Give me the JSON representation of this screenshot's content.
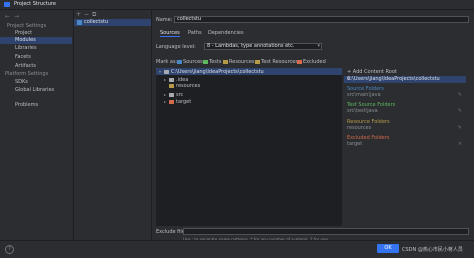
{
  "window": {
    "title": "Project Structure"
  },
  "sidebar": {
    "nav_back": "←",
    "nav_forward": "→",
    "sections": [
      {
        "title": "Project Settings",
        "items": [
          "Project",
          "Modules",
          "Libraries",
          "Facets",
          "Artifacts"
        ]
      },
      {
        "title": "Platform Settings",
        "items": [
          "SDKs",
          "Global Libraries"
        ]
      }
    ],
    "extra_items": [
      "Problems"
    ],
    "selected": "Modules"
  },
  "module_list": {
    "toolbar": [
      "+",
      "−",
      "⧉"
    ],
    "modules": [
      "collectstu"
    ]
  },
  "module": {
    "name_label": "Name:",
    "name_value": "collectstu",
    "tabs": [
      "Sources",
      "Paths",
      "Dependencies"
    ],
    "selected_tab": "Sources",
    "language_level_label": "Language level:",
    "language_level_value": "8 - Lambdas, type annotations etc."
  },
  "mark_as": {
    "label": "Mark as:",
    "options": [
      {
        "label": "Sources",
        "color": "#4a88c7"
      },
      {
        "label": "Tests",
        "color": "#5fb760"
      },
      {
        "label": "Resources",
        "color": "#b89b48"
      },
      {
        "label": "Test Resources",
        "color": "#b89b48"
      },
      {
        "label": "Excluded",
        "color": "#d46b4b"
      }
    ]
  },
  "tree": {
    "root": "C:\\Users\\jiang\\IdeaProjects\\collectstu",
    "children": [
      {
        "label": ".idea",
        "expanded": false
      },
      {
        "label": "resources",
        "expanded": false
      },
      {
        "label": "src",
        "expanded": false
      },
      {
        "label": "target",
        "expanded": false
      }
    ]
  },
  "content_roots": {
    "add_label": "+ Add Content Root",
    "root_path": "C:\\Users\\jiang\\IdeaProjects\\collectstu",
    "close": "×",
    "groups": [
      {
        "title": "Source Folders",
        "value": "src\\main\\java",
        "color": "#4a88c7"
      },
      {
        "title": "Test Source Folders",
        "value": "src\\test\\java",
        "color": "#5fb760"
      },
      {
        "title": "Resource Folders",
        "value": "resources",
        "color": "#b89b48"
      },
      {
        "title": "Excluded Folders",
        "value": "target",
        "color": "#d46b4b"
      }
    ]
  },
  "exclude": {
    "label": "Exclude files:",
    "value": "",
    "hint": "Use ; to separate name patterns, * for any number of symbols, ? for one."
  },
  "footer": {
    "help": "?",
    "ok_label": "OK",
    "watermark": "CSDN @热心市民小蒋人员"
  },
  "colors": {
    "accent": "#3574f0",
    "selection": "#2e436e",
    "background": "#2b2d30"
  }
}
